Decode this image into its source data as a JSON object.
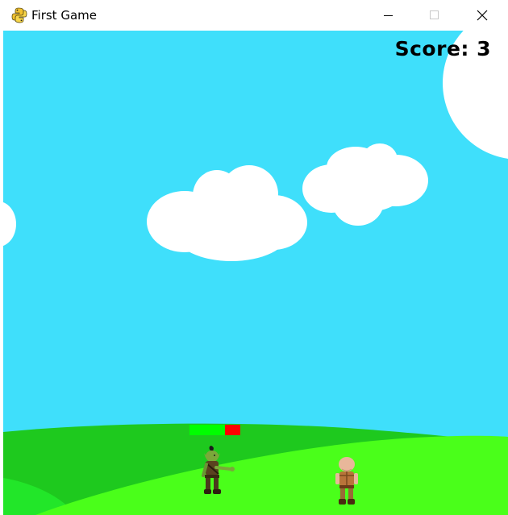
{
  "window": {
    "title": "First Game",
    "app_icon": "python-snake-icon",
    "controls": [
      "minimize-icon",
      "maximize-icon",
      "close-icon"
    ]
  },
  "game": {
    "score_label": "Score: 3",
    "enemy_health_fraction": 0.7,
    "colors": {
      "sky": "#3fdffb",
      "cloud": "#ffffff",
      "hill_dark": "#1ec91e",
      "hill_light": "#4aff1a",
      "health_remaining": "#00ff00",
      "health_lost": "#ff0000",
      "score_text": "#000000"
    },
    "sprites": {
      "enemy": "goblin-enemy",
      "player": "bald-warrior-player"
    }
  }
}
